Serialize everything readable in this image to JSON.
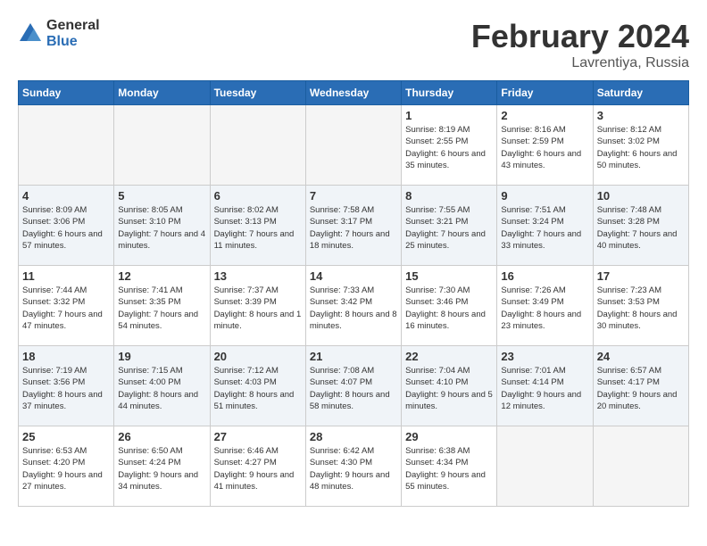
{
  "logo": {
    "general": "General",
    "blue": "Blue"
  },
  "title": "February 2024",
  "location": "Lavrentiya, Russia",
  "days_of_week": [
    "Sunday",
    "Monday",
    "Tuesday",
    "Wednesday",
    "Thursday",
    "Friday",
    "Saturday"
  ],
  "weeks": [
    [
      {
        "day": "",
        "info": ""
      },
      {
        "day": "",
        "info": ""
      },
      {
        "day": "",
        "info": ""
      },
      {
        "day": "",
        "info": ""
      },
      {
        "day": "1",
        "info": "Sunrise: 8:19 AM\nSunset: 2:55 PM\nDaylight: 6 hours\nand 35 minutes."
      },
      {
        "day": "2",
        "info": "Sunrise: 8:16 AM\nSunset: 2:59 PM\nDaylight: 6 hours\nand 43 minutes."
      },
      {
        "day": "3",
        "info": "Sunrise: 8:12 AM\nSunset: 3:02 PM\nDaylight: 6 hours\nand 50 minutes."
      }
    ],
    [
      {
        "day": "4",
        "info": "Sunrise: 8:09 AM\nSunset: 3:06 PM\nDaylight: 6 hours\nand 57 minutes."
      },
      {
        "day": "5",
        "info": "Sunrise: 8:05 AM\nSunset: 3:10 PM\nDaylight: 7 hours\nand 4 minutes."
      },
      {
        "day": "6",
        "info": "Sunrise: 8:02 AM\nSunset: 3:13 PM\nDaylight: 7 hours\nand 11 minutes."
      },
      {
        "day": "7",
        "info": "Sunrise: 7:58 AM\nSunset: 3:17 PM\nDaylight: 7 hours\nand 18 minutes."
      },
      {
        "day": "8",
        "info": "Sunrise: 7:55 AM\nSunset: 3:21 PM\nDaylight: 7 hours\nand 25 minutes."
      },
      {
        "day": "9",
        "info": "Sunrise: 7:51 AM\nSunset: 3:24 PM\nDaylight: 7 hours\nand 33 minutes."
      },
      {
        "day": "10",
        "info": "Sunrise: 7:48 AM\nSunset: 3:28 PM\nDaylight: 7 hours\nand 40 minutes."
      }
    ],
    [
      {
        "day": "11",
        "info": "Sunrise: 7:44 AM\nSunset: 3:32 PM\nDaylight: 7 hours\nand 47 minutes."
      },
      {
        "day": "12",
        "info": "Sunrise: 7:41 AM\nSunset: 3:35 PM\nDaylight: 7 hours\nand 54 minutes."
      },
      {
        "day": "13",
        "info": "Sunrise: 7:37 AM\nSunset: 3:39 PM\nDaylight: 8 hours\nand 1 minute."
      },
      {
        "day": "14",
        "info": "Sunrise: 7:33 AM\nSunset: 3:42 PM\nDaylight: 8 hours\nand 8 minutes."
      },
      {
        "day": "15",
        "info": "Sunrise: 7:30 AM\nSunset: 3:46 PM\nDaylight: 8 hours\nand 16 minutes."
      },
      {
        "day": "16",
        "info": "Sunrise: 7:26 AM\nSunset: 3:49 PM\nDaylight: 8 hours\nand 23 minutes."
      },
      {
        "day": "17",
        "info": "Sunrise: 7:23 AM\nSunset: 3:53 PM\nDaylight: 8 hours\nand 30 minutes."
      }
    ],
    [
      {
        "day": "18",
        "info": "Sunrise: 7:19 AM\nSunset: 3:56 PM\nDaylight: 8 hours\nand 37 minutes."
      },
      {
        "day": "19",
        "info": "Sunrise: 7:15 AM\nSunset: 4:00 PM\nDaylight: 8 hours\nand 44 minutes."
      },
      {
        "day": "20",
        "info": "Sunrise: 7:12 AM\nSunset: 4:03 PM\nDaylight: 8 hours\nand 51 minutes."
      },
      {
        "day": "21",
        "info": "Sunrise: 7:08 AM\nSunset: 4:07 PM\nDaylight: 8 hours\nand 58 minutes."
      },
      {
        "day": "22",
        "info": "Sunrise: 7:04 AM\nSunset: 4:10 PM\nDaylight: 9 hours\nand 5 minutes."
      },
      {
        "day": "23",
        "info": "Sunrise: 7:01 AM\nSunset: 4:14 PM\nDaylight: 9 hours\nand 12 minutes."
      },
      {
        "day": "24",
        "info": "Sunrise: 6:57 AM\nSunset: 4:17 PM\nDaylight: 9 hours\nand 20 minutes."
      }
    ],
    [
      {
        "day": "25",
        "info": "Sunrise: 6:53 AM\nSunset: 4:20 PM\nDaylight: 9 hours\nand 27 minutes."
      },
      {
        "day": "26",
        "info": "Sunrise: 6:50 AM\nSunset: 4:24 PM\nDaylight: 9 hours\nand 34 minutes."
      },
      {
        "day": "27",
        "info": "Sunrise: 6:46 AM\nSunset: 4:27 PM\nDaylight: 9 hours\nand 41 minutes."
      },
      {
        "day": "28",
        "info": "Sunrise: 6:42 AM\nSunset: 4:30 PM\nDaylight: 9 hours\nand 48 minutes."
      },
      {
        "day": "29",
        "info": "Sunrise: 6:38 AM\nSunset: 4:34 PM\nDaylight: 9 hours\nand 55 minutes."
      },
      {
        "day": "",
        "info": ""
      },
      {
        "day": "",
        "info": ""
      }
    ]
  ]
}
